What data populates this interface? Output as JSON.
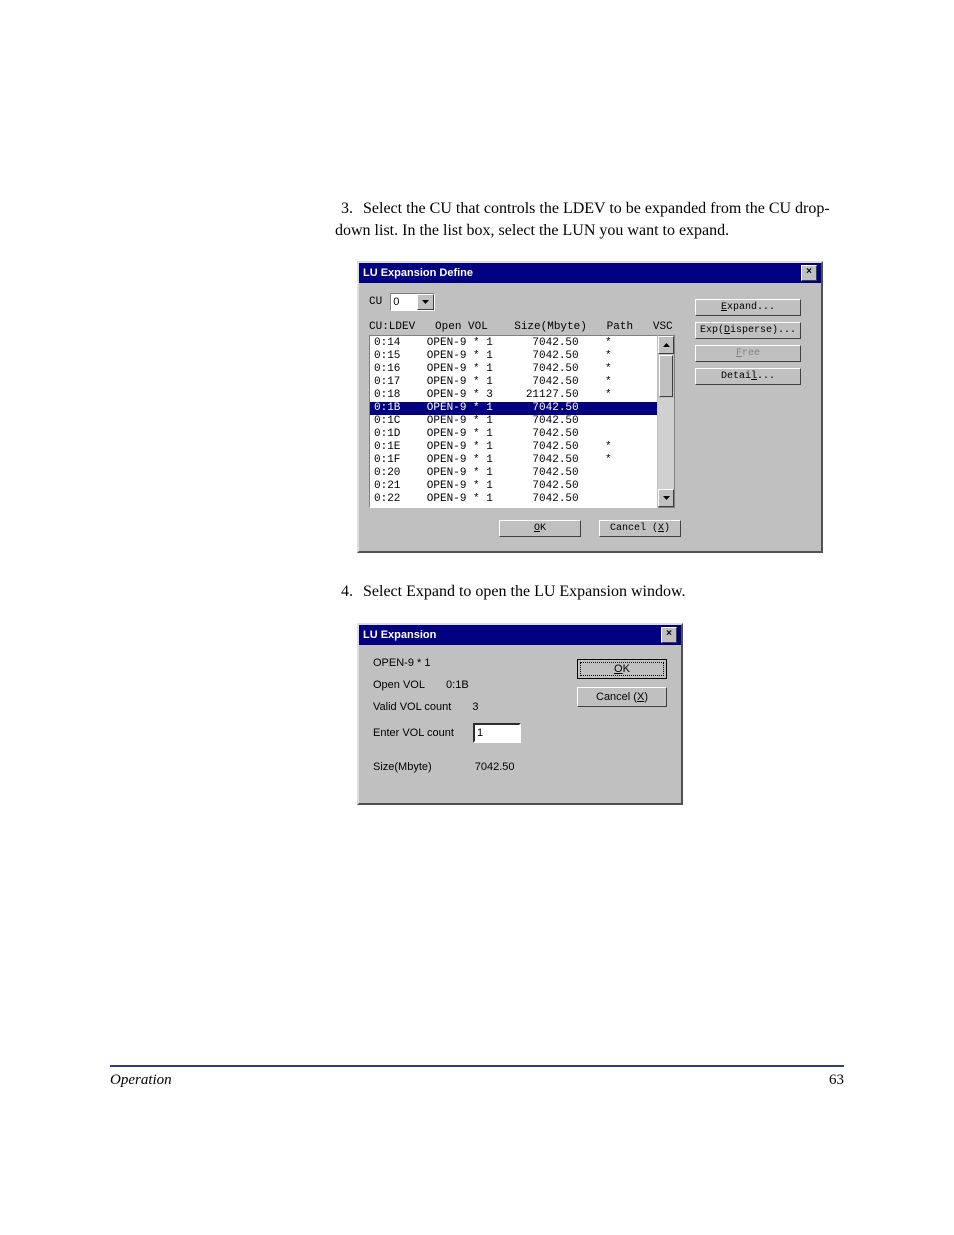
{
  "steps": {
    "s3": {
      "num": "3.",
      "text": "Select the CU that controls the LDEV to be expanded from the CU drop-down list. In the list box, select the LUN you want to expand."
    },
    "s4": {
      "num": "4.",
      "text": "Select Expand to open the LU Expansion window."
    }
  },
  "dialog1": {
    "title": "LU Expansion Define",
    "cu_label": "CU",
    "cu_value": "0",
    "header": "CU:LDEV   Open VOL    Size(Mbyte)   Path   VSC",
    "rows": [
      {
        "cu": "0:14",
        "vol": "OPEN-9 * 1",
        "size": "7042.50",
        "path": "*",
        "vsc": "",
        "selected": false
      },
      {
        "cu": "0:15",
        "vol": "OPEN-9 * 1",
        "size": "7042.50",
        "path": "*",
        "vsc": "",
        "selected": false
      },
      {
        "cu": "0:16",
        "vol": "OPEN-9 * 1",
        "size": "7042.50",
        "path": "*",
        "vsc": "",
        "selected": false
      },
      {
        "cu": "0:17",
        "vol": "OPEN-9 * 1",
        "size": "7042.50",
        "path": "*",
        "vsc": "",
        "selected": false
      },
      {
        "cu": "0:18",
        "vol": "OPEN-9 * 3",
        "size": "21127.50",
        "path": "*",
        "vsc": "",
        "selected": false
      },
      {
        "cu": "0:1B",
        "vol": "OPEN-9 * 1",
        "size": "7042.50",
        "path": "",
        "vsc": "",
        "selected": true
      },
      {
        "cu": "0:1C",
        "vol": "OPEN-9 * 1",
        "size": "7042.50",
        "path": "",
        "vsc": "",
        "selected": false
      },
      {
        "cu": "0:1D",
        "vol": "OPEN-9 * 1",
        "size": "7042.50",
        "path": "",
        "vsc": "",
        "selected": false
      },
      {
        "cu": "0:1E",
        "vol": "OPEN-9 * 1",
        "size": "7042.50",
        "path": "*",
        "vsc": "",
        "selected": false
      },
      {
        "cu": "0:1F",
        "vol": "OPEN-9 * 1",
        "size": "7042.50",
        "path": "*",
        "vsc": "",
        "selected": false
      },
      {
        "cu": "0:20",
        "vol": "OPEN-9 * 1",
        "size": "7042.50",
        "path": "",
        "vsc": "",
        "selected": false
      },
      {
        "cu": "0:21",
        "vol": "OPEN-9 * 1",
        "size": "7042.50",
        "path": "",
        "vsc": "",
        "selected": false
      },
      {
        "cu": "0:22",
        "vol": "OPEN-9 * 1",
        "size": "7042.50",
        "path": "",
        "vsc": "",
        "selected": false
      }
    ],
    "buttons": {
      "expand": {
        "pre": "",
        "u": "E",
        "post": "xpand..."
      },
      "exp_disperse": {
        "pre": "Exp(",
        "u": "D",
        "post": "isperse)..."
      },
      "free": {
        "pre": "",
        "u": "F",
        "post": "ree",
        "disabled": true
      },
      "detail": {
        "pre": "Detai",
        "u": "l",
        "post": "..."
      },
      "ok": {
        "pre": "",
        "u": "O",
        "post": "K"
      },
      "cancel": {
        "pre": "Cancel (",
        "u": "X",
        "post": ")"
      }
    }
  },
  "dialog2": {
    "title": "LU Expansion",
    "line1": "OPEN-9 * 1",
    "openvol_label": "Open VOL",
    "openvol_value": "0:1B",
    "validcount_label": "Valid VOL count",
    "validcount_value": "3",
    "entercount_label": "Enter VOL count",
    "entercount_value": "1",
    "size_label": "Size(Mbyte)",
    "size_value": "7042.50",
    "buttons": {
      "ok": {
        "pre": "",
        "u": "O",
        "post": "K"
      },
      "cancel": {
        "pre": "Cancel (",
        "u": "X",
        "post": ")"
      }
    }
  },
  "footer": {
    "section": "Operation",
    "page": "63"
  }
}
